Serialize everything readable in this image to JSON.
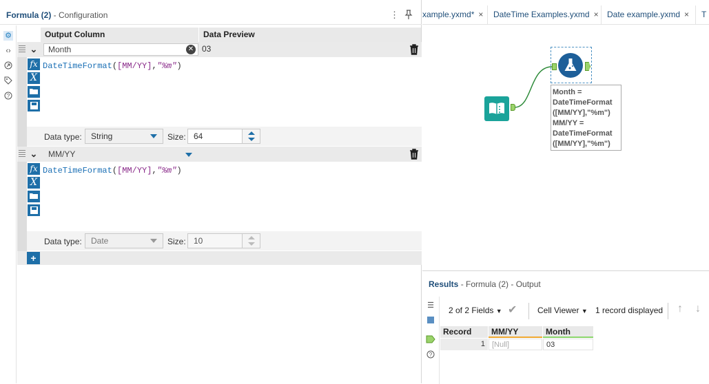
{
  "config": {
    "title_bold": "Formula (2)",
    "title_rest": " - Configuration",
    "headers": {
      "output_column": "Output Column",
      "data_preview": "Data Preview"
    },
    "rows": [
      {
        "field": "Month",
        "preview": "03",
        "expr_fn": "DateTimeFormat",
        "expr_open": "(",
        "expr_field": "[MM/YY]",
        "expr_comma": ",",
        "expr_str": "\"%m\"",
        "expr_close": ")",
        "data_type_label": "Data type:",
        "data_type": "String",
        "size_label": "Size:",
        "size": "64"
      },
      {
        "field": "MM/YY",
        "preview": "",
        "expr_fn": "DateTimeFormat",
        "expr_open": "(",
        "expr_field": "[MM/YY]",
        "expr_comma": ",",
        "expr_str": "\"%m\"",
        "expr_close": ")",
        "data_type_label": "Data type:",
        "data_type": "Date",
        "size_label": "Size:",
        "size": "10"
      }
    ],
    "tool_icons": [
      "fx-icon",
      "variable-icon",
      "open-folder-icon",
      "save-icon"
    ],
    "add_label": "+"
  },
  "tabs": [
    {
      "label": "xample.yxmd*",
      "close": "×"
    },
    {
      "label": "DateTime Examples.yxmd",
      "close": "×"
    },
    {
      "label": "Date example.yxmd",
      "close": "×"
    },
    {
      "label": "T",
      "close": ""
    }
  ],
  "canvas": {
    "annotation": [
      "Month =",
      "DateTimeFormat",
      "([MM/YY],\"%m\")",
      "MM/YY =",
      "DateTimeFormat",
      "([MM/YY],\"%m\")"
    ],
    "connector_color": "#2e8b3a",
    "input_tool_color": "#1aa39a",
    "formula_tool_color": "#1d5f99"
  },
  "results": {
    "title_bold": "Results",
    "title_rest": " - Formula (2) - Output",
    "fields": "2 of 2 Fields",
    "viewer": "Cell Viewer",
    "records": "1 record displayed",
    "columns": [
      "Record",
      "MM/YY",
      "Month"
    ],
    "row": {
      "record": "1",
      "mmyy": "[Null]",
      "month": "03"
    },
    "underline_colors": [
      "#ffffff",
      "#f0a830",
      "#8bd66b"
    ]
  }
}
